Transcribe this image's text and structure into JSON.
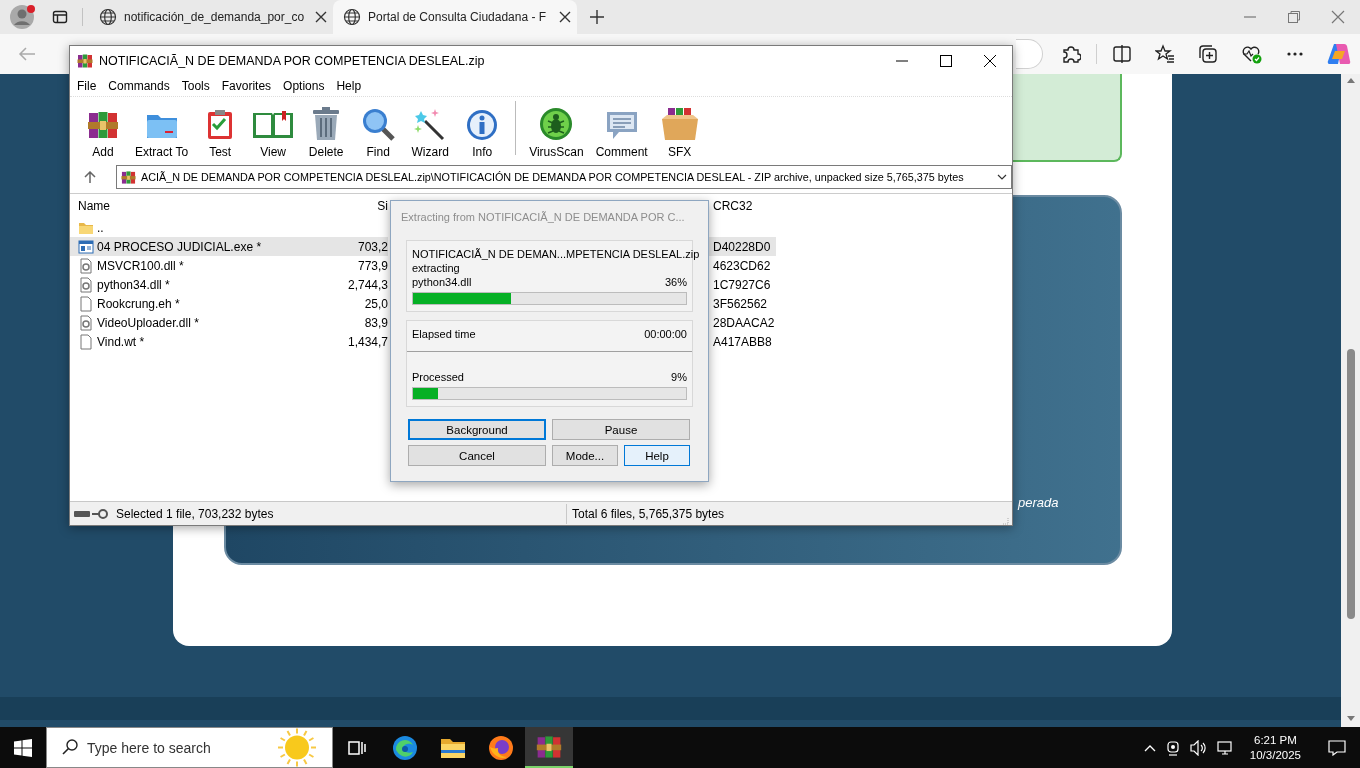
{
  "browser": {
    "tabs": [
      {
        "title": "notificación_de_demanda_por_co",
        "selected": false
      },
      {
        "title": "Portal de Consulta Ciudadana - F",
        "selected": true
      }
    ]
  },
  "page": {
    "caption": "perada"
  },
  "winrar": {
    "title": "NOTIFICACIÃ_N DE DEMANDA POR COMPETENCIA DESLEAL.zip",
    "menu": [
      "File",
      "Commands",
      "Tools",
      "Favorites",
      "Options",
      "Help"
    ],
    "toolbar": [
      "Add",
      "Extract To",
      "Test",
      "View",
      "Delete",
      "Find",
      "Wizard",
      "Info",
      "VirusScan",
      "Comment",
      "SFX"
    ],
    "path": "ACIÃ_N DE DEMANDA POR COMPETENCIA DESLEAL.zip\\NOTIFICACIÓN DE DEMANDA POR COMPETENCIA DESLEAL - ZIP archive, unpacked size 5,765,375 bytes",
    "columns": [
      "Name",
      "Si",
      "CRC32"
    ],
    "files": [
      {
        "kind": "folder",
        "name": "..",
        "selected": false
      },
      {
        "kind": "exe",
        "name": "04 PROCESO JUDICIAL.exe *",
        "size": "703,2",
        "crc": "D40228D0",
        "selected": true
      },
      {
        "kind": "dll",
        "name": "MSVCR100.dll *",
        "size": "773,9",
        "crc": "4623CD62",
        "selected": false
      },
      {
        "kind": "dll",
        "name": "python34.dll *",
        "size": "2,744,3",
        "crc": "1C7927C6",
        "selected": false
      },
      {
        "kind": "file",
        "name": "Rookcrung.eh *",
        "size": "25,0",
        "crc": "3F562562",
        "selected": false
      },
      {
        "kind": "dll",
        "name": "VideoUploader.dll *",
        "size": "83,9",
        "crc": "28DAACA2",
        "selected": false
      },
      {
        "kind": "file",
        "name": "Vind.wt *",
        "size": "1,434,7",
        "crc": "A417ABB8",
        "selected": false
      }
    ],
    "status": {
      "selected": "Selected 1 file, 703,232 bytes",
      "total": "Total 6 files, 5,765,375 bytes"
    }
  },
  "dialog": {
    "title": "Extracting from NOTIFICACIÃ_N DE DEMANDA POR C...",
    "archive": "NOTIFICACIÃ_N DE DEMAN...MPETENCIA DESLEAL.zip",
    "action": "extracting",
    "file": "python34.dll",
    "file_percent": "36%",
    "file_bar": {
      "level": 0.36
    },
    "elapsed_label": "Elapsed time",
    "elapsed": "00:00:00",
    "processed_label": "Processed",
    "processed_percent": "9%",
    "processed_bar": {
      "level": 0.09
    },
    "buttons": [
      {
        "label": "Background",
        "focused": true,
        "hovered": false
      },
      {
        "label": "Pause",
        "focused": false,
        "hovered": false
      },
      {
        "label": "Cancel",
        "focused": false,
        "hovered": false
      },
      {
        "label": "Mode...",
        "focused": false,
        "hovered": false
      },
      {
        "label": "Help",
        "focused": false,
        "hovered": true
      }
    ]
  },
  "taskbar": {
    "search_placeholder": "Type here to search",
    "apps": [
      {
        "selected": false
      },
      {
        "selected": false
      },
      {
        "selected": false
      },
      {
        "selected": false
      },
      {
        "selected": true
      }
    ],
    "time": "6:21 PM",
    "date": "10/3/2025"
  }
}
